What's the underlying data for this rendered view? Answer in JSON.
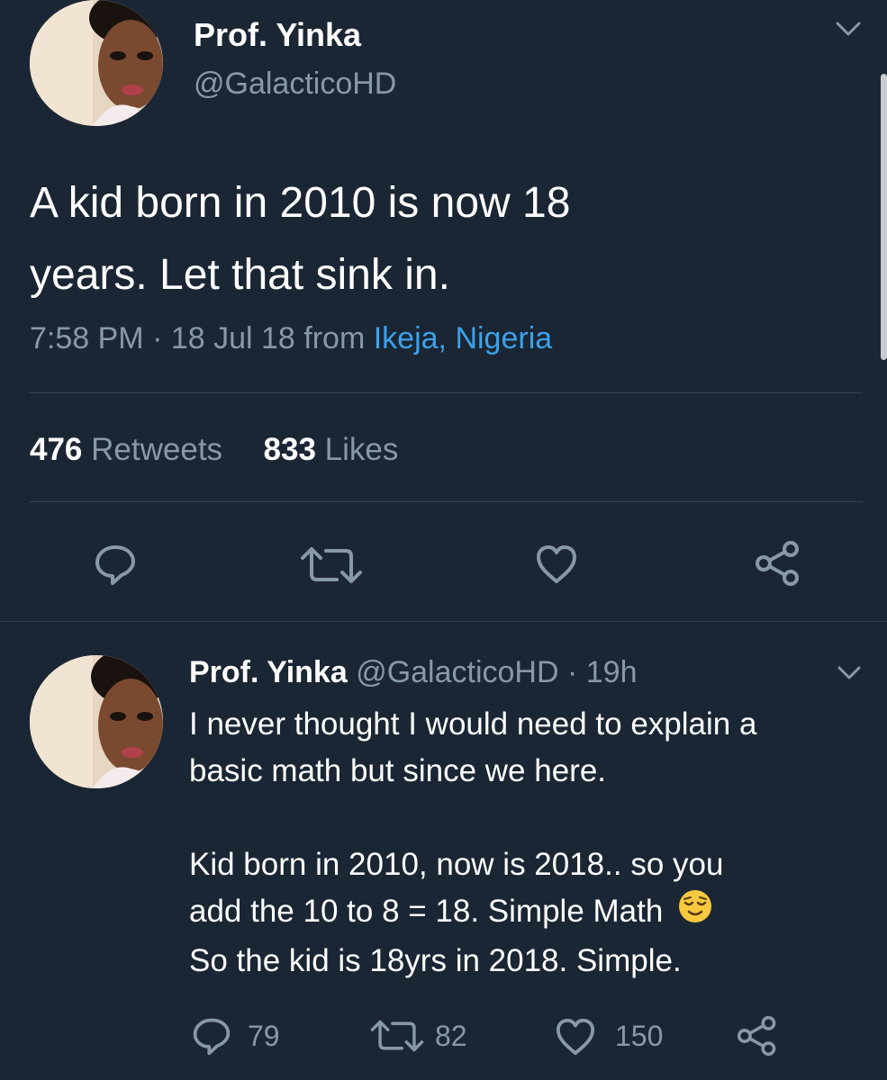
{
  "main_tweet": {
    "display_name": "Prof. Yinka",
    "handle": "@GalacticoHD",
    "text_line1": "A kid born in 2010 is now 18",
    "text_line2": "years. Let that sink in.",
    "time": "7:58 PM · 18 Jul 18 from ",
    "location": "Ikeja, Nigeria",
    "retweets_count": "476",
    "retweets_label": "Retweets",
    "likes_count": "833",
    "likes_label": "Likes"
  },
  "reply": {
    "display_name": "Prof. Yinka",
    "handle_time": "@GalacticoHD · 19h",
    "line1": "I never thought I would need to explain a",
    "line2": "basic math but since we here.",
    "line3": "Kid born in 2010, now is 2018.. so you",
    "line4": "add the 10 to 8 = 18. Simple Math",
    "line5": "So the kid is 18yrs in 2018. Simple.",
    "reply_count": "79",
    "retweet_count": "82",
    "like_count": "150"
  },
  "colors": {
    "background": "#1b2634",
    "muted": "#8899a6",
    "link": "#3ea1e8",
    "divider": "#38444d"
  },
  "icons": [
    "reply-icon",
    "retweet-icon",
    "like-icon",
    "share-icon",
    "chevron-down-icon",
    "relieved-face-emoji"
  ]
}
